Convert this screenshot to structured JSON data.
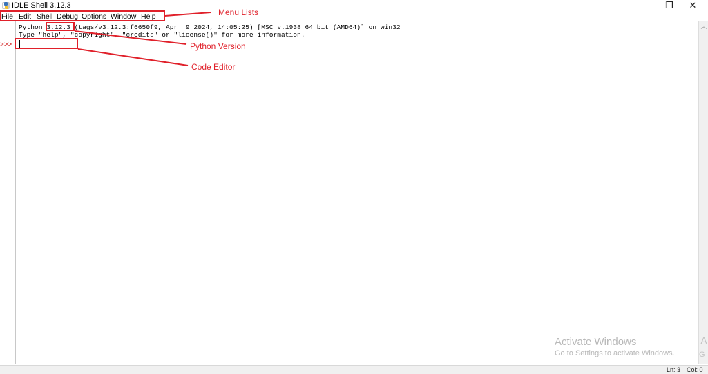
{
  "window": {
    "title": "IDLE Shell 3.12.3",
    "icon": "python-idle-icon",
    "controls": {
      "minimize": "–",
      "maximize": "❐",
      "close": "✕"
    }
  },
  "menubar": {
    "items": [
      {
        "label": "File"
      },
      {
        "label": "Edit"
      },
      {
        "label": "Shell"
      },
      {
        "label": "Debug"
      },
      {
        "label": "Options"
      },
      {
        "label": "Window"
      },
      {
        "label": "Help"
      }
    ]
  },
  "shell": {
    "lines": [
      "Python 3.12.3 (tags/v3.12.3:f6650f9, Apr  9 2024, 14:05:25) [MSC v.1938 64 bit (AMD64)] on win32",
      "Type \"help\", \"copyright\", \"credits\" or \"license()\" for more information."
    ],
    "prompt": ">>>"
  },
  "annotations": {
    "menu_lists": "Menu Lists",
    "python_version": "Python Version",
    "code_editor": "Code Editor",
    "color": "#e0202a"
  },
  "status": {
    "line": "Ln: 3",
    "col": "Col: 0"
  },
  "watermark": {
    "title": "Activate Windows",
    "subtitle": "Go to Settings to activate Windows.",
    "edge_top": "A",
    "edge_bottom": "G"
  }
}
